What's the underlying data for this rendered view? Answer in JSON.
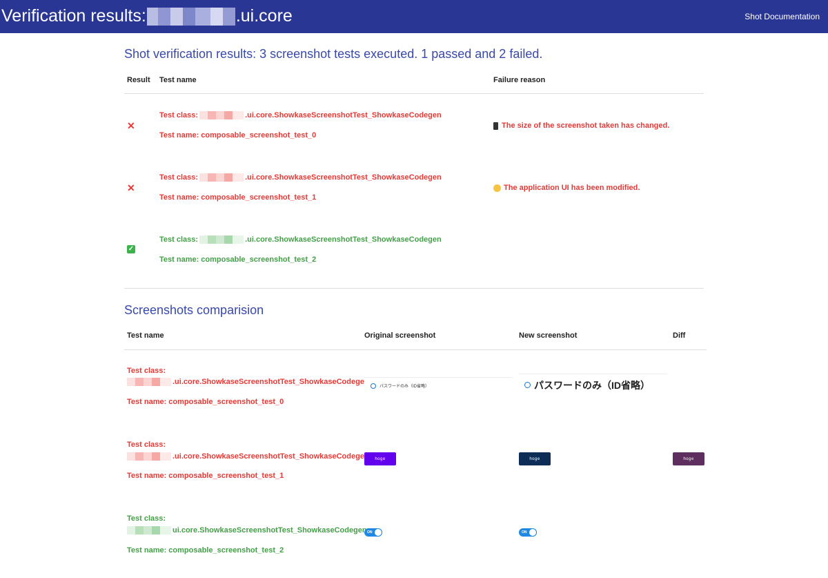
{
  "header": {
    "title_prefix": "Verification results:",
    "title_suffix": ".ui.core",
    "doc_link": "Shot Documentation"
  },
  "results": {
    "summary": "Shot verification results: 3 screenshot tests executed. 1 passed and 2 failed.",
    "columns": [
      "Result",
      "Test name",
      "Failure reason"
    ],
    "rows": [
      {
        "status": "failed",
        "class_prefix": "Test class:",
        "class_suffix": ".ui.core.ShowkaseScreenshotTest_ShowkaseCodegen",
        "name": "Test name: composable_screenshot_test_0",
        "reason": "The size of the screenshot taken has changed.",
        "reason_icon": "phone-icon"
      },
      {
        "status": "failed",
        "class_prefix": "Test class:",
        "class_suffix": ".ui.core.ShowkaseScreenshotTest_ShowkaseCodegen",
        "name": "Test name: composable_screenshot_test_1",
        "reason": "The application UI has been modified.",
        "reason_icon": "thinking-face-icon"
      },
      {
        "status": "passed",
        "class_prefix": "Test class:",
        "class_suffix": ".ui.core.ShowkaseScreenshotTest_ShowkaseCodegen",
        "name": "Test name: composable_screenshot_test_2",
        "reason": ""
      }
    ]
  },
  "comparison": {
    "title": "Screenshots comparision",
    "columns": [
      "Test name",
      "Original screenshot",
      "New screenshot",
      "Diff"
    ],
    "rows": [
      {
        "status": "failed",
        "class_prefix": "Test class:",
        "class_suffix": ".ui.core.ShowkaseScreenshotTest_ShowkaseCodegen",
        "name": "Test name: composable_screenshot_test_0",
        "original_text": "パスワードのみ（ID省略）",
        "new_text": "パスワードのみ（ID省略）"
      },
      {
        "status": "failed",
        "class_prefix": "Test class:",
        "class_suffix": ".ui.core.ShowkaseScreenshotTest_ShowkaseCodegen",
        "name": "Test name: composable_screenshot_test_1",
        "original_text": "hoge",
        "new_text": "hoge",
        "diff_text": "hoge",
        "original_color": "#6200ee",
        "new_color": "#0d2d57",
        "diff_color": "#5e2f5e"
      },
      {
        "status": "passed",
        "class_prefix": "Test class:",
        "class_suffix": "ui.core.ShowkaseScreenshotTest_ShowkaseCodegen",
        "name": "Test name: composable_screenshot_test_2",
        "original_text": "ON",
        "new_text": "ON"
      }
    ]
  },
  "colors": {
    "header_bg": "#2a3694",
    "accent": "#3949ab",
    "fail": "#e53935",
    "pass": "#43a047"
  }
}
